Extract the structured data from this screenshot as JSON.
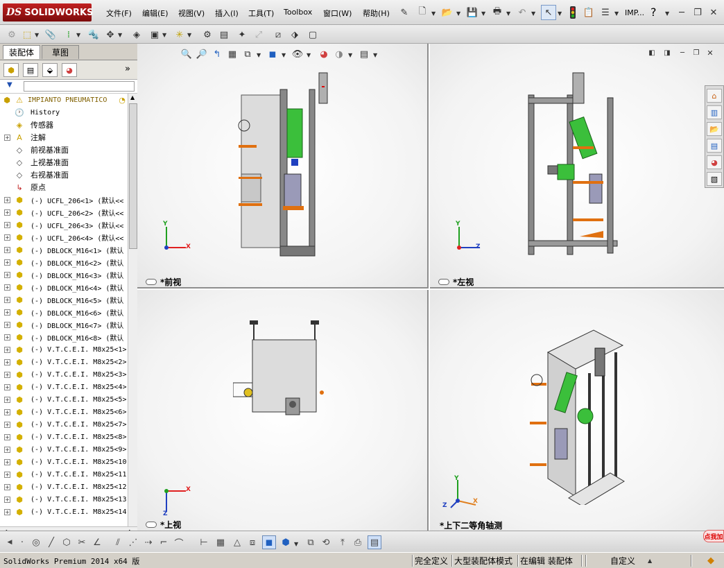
{
  "app": {
    "logo_ds": "DS",
    "logo_name": "SOLIDWORKS",
    "doc_abbrev": "IMP...",
    "help_symbol": "?"
  },
  "menu": [
    "文件(F)",
    "编辑(E)",
    "视图(V)",
    "插入(I)",
    "工具(T)",
    "Toolbox",
    "窗口(W)",
    "帮助(H)"
  ],
  "left_tabs": {
    "assembly": "装配体",
    "sketch": "草图"
  },
  "filter_symbol": "▼",
  "collapse_symbol": "»",
  "tree": {
    "root": "IMPIANTO PNEUMATICO",
    "items": [
      {
        "label": "History",
        "icon": "history-icon",
        "expand": false
      },
      {
        "label": "传感器",
        "icon": "sensors-icon",
        "expand": false
      },
      {
        "label": "注解",
        "icon": "annotations-icon",
        "expand": true
      },
      {
        "label": "前视基准面",
        "icon": "plane-icon",
        "expand": false
      },
      {
        "label": "上视基准面",
        "icon": "plane-icon",
        "expand": false
      },
      {
        "label": "右视基准面",
        "icon": "plane-icon",
        "expand": false
      },
      {
        "label": "原点",
        "icon": "origin-icon",
        "expand": false
      },
      {
        "label": "(-) UCFL_206<1> (默认<<",
        "icon": "part-icon",
        "expand": true
      },
      {
        "label": "(-) UCFL_206<2> (默认<<",
        "icon": "part-icon",
        "expand": true
      },
      {
        "label": "(-) UCFL_206<3> (默认<<",
        "icon": "part-icon",
        "expand": true
      },
      {
        "label": "(-) UCFL_206<4> (默认<<",
        "icon": "part-icon",
        "expand": true
      },
      {
        "label": "(-) DBLOCK_M16<1> (默认",
        "icon": "part-icon",
        "expand": true
      },
      {
        "label": "(-) DBLOCK_M16<2> (默认",
        "icon": "part-icon",
        "expand": true
      },
      {
        "label": "(-) DBLOCK_M16<3> (默认",
        "icon": "part-icon",
        "expand": true
      },
      {
        "label": "(-) DBLOCK_M16<4> (默认",
        "icon": "part-icon",
        "expand": true
      },
      {
        "label": "(-) DBLOCK_M16<5> (默认",
        "icon": "part-icon",
        "expand": true
      },
      {
        "label": "(-) DBLOCK_M16<6> (默认",
        "icon": "part-icon",
        "expand": true
      },
      {
        "label": "(-) DBLOCK_M16<7> (默认",
        "icon": "part-icon",
        "expand": true
      },
      {
        "label": "(-) DBLOCK_M16<8> (默认",
        "icon": "part-icon",
        "expand": true
      },
      {
        "label": "(-) V.T.C.E.I. M8x25<1>",
        "icon": "part-icon",
        "expand": true
      },
      {
        "label": "(-) V.T.C.E.I. M8x25<2>",
        "icon": "part-icon",
        "expand": true
      },
      {
        "label": "(-) V.T.C.E.I. M8x25<3>",
        "icon": "part-icon",
        "expand": true
      },
      {
        "label": "(-) V.T.C.E.I. M8x25<4>",
        "icon": "part-icon",
        "expand": true
      },
      {
        "label": "(-) V.T.C.E.I. M8x25<5>",
        "icon": "part-icon",
        "expand": true
      },
      {
        "label": "(-) V.T.C.E.I. M8x25<6>",
        "icon": "part-icon",
        "expand": true
      },
      {
        "label": "(-) V.T.C.E.I. M8x25<7>",
        "icon": "part-icon",
        "expand": true
      },
      {
        "label": "(-) V.T.C.E.I. M8x25<8>",
        "icon": "part-icon",
        "expand": true
      },
      {
        "label": "(-) V.T.C.E.I. M8x25<9>",
        "icon": "part-icon",
        "expand": true
      },
      {
        "label": "(-) V.T.C.E.I. M8x25<10",
        "icon": "part-icon",
        "expand": true
      },
      {
        "label": "(-) V.T.C.E.I. M8x25<11",
        "icon": "part-icon",
        "expand": true
      },
      {
        "label": "(-) V.T.C.E.I. M8x25<12",
        "icon": "part-icon",
        "expand": true
      },
      {
        "label": "(-) V.T.C.E.I. M8x25<13",
        "icon": "part-icon",
        "expand": true
      },
      {
        "label": "(-) V.T.C.E.I. M8x25<14",
        "icon": "part-icon",
        "expand": true
      }
    ]
  },
  "viewports": {
    "front": {
      "label": "*前视"
    },
    "left": {
      "label": "*左视"
    },
    "top": {
      "label": "*上视"
    },
    "iso": {
      "label": "*上下二等角轴测"
    }
  },
  "axes": {
    "x": "X",
    "y": "Y",
    "z": "Z"
  },
  "status": {
    "version": "SolidWorks Premium 2014 x64 版",
    "defined": "完全定义",
    "mode": "大型装配体模式",
    "editing": "在编辑 装配体",
    "custom": "自定义"
  },
  "badge": "点我加",
  "colors": {
    "accent_red": "#b31b1b",
    "green_part": "#2fb52f",
    "axis_red": "#e02020",
    "axis_green": "#20a020",
    "axis_blue": "#2040c0"
  }
}
